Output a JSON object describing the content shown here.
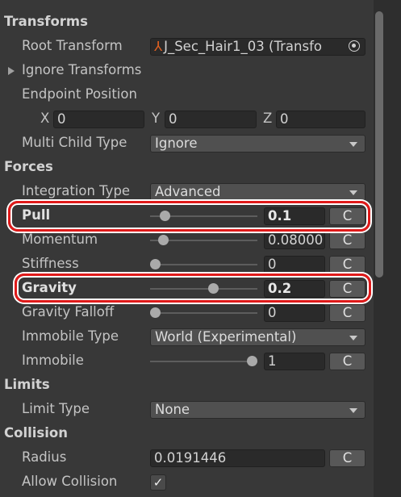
{
  "sections": {
    "transforms": "Transforms",
    "forces": "Forces",
    "limits": "Limits",
    "collision": "Collision"
  },
  "transforms": {
    "root_transform_label": "Root Transform",
    "root_transform_value": "J_Sec_Hair1_03 (Transfo",
    "ignore_transforms_label": "Ignore Transforms",
    "endpoint_label": "Endpoint Position",
    "x_label": "X",
    "x_value": "0",
    "y_label": "Y",
    "y_value": "0",
    "z_label": "Z",
    "z_value": "0",
    "multi_child_label": "Multi Child Type",
    "multi_child_value": "Ignore"
  },
  "forces": {
    "integration_label": "Integration Type",
    "integration_value": "Advanced",
    "pull_label": "Pull",
    "pull_value": "0.1",
    "pull_level": 0.1,
    "momentum_label": "Momentum",
    "momentum_value": "0.08000",
    "momentum_level": 0.08,
    "stiffness_label": "Stiffness",
    "stiffness_value": "0",
    "stiffness_level": 0,
    "gravity_label": "Gravity",
    "gravity_value": "0.2",
    "gravity_level": 0.6,
    "gravity_falloff_label": "Gravity Falloff",
    "gravity_falloff_value": "0",
    "gravity_falloff_level": 0,
    "immobile_type_label": "Immobile Type",
    "immobile_type_value": "World (Experimental)",
    "immobile_label": "Immobile",
    "immobile_value": "1",
    "immobile_level": 1
  },
  "limits": {
    "limit_type_label": "Limit Type",
    "limit_type_value": "None"
  },
  "collision": {
    "radius_label": "Radius",
    "radius_value": "0.0191446",
    "allow_collision_label": "Allow Collision",
    "allow_collision_checked": "✓"
  },
  "curve_button": "C",
  "highlight_color": "#e01a1a"
}
